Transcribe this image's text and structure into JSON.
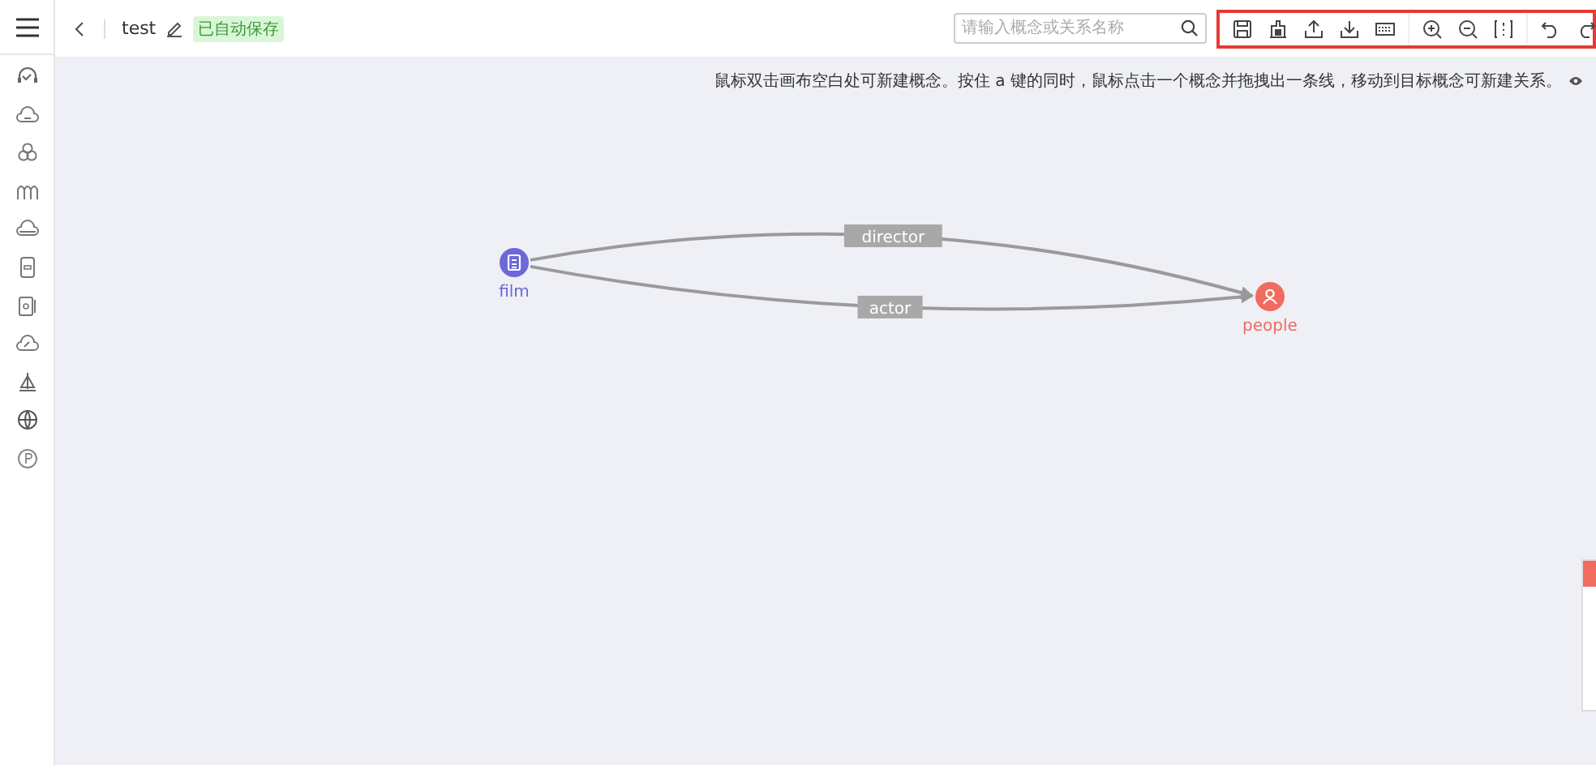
{
  "header": {
    "title": "test",
    "save_status": "已自动保存"
  },
  "search": {
    "placeholder": "请输入概念或关系名称"
  },
  "hint": "鼠标双击画布空白处可新建概念。按住 a 键的同时，鼠标点击一个概念并拖拽出一条线，移动到目标概念可新建关系。",
  "graph": {
    "nodes": [
      {
        "name": "film",
        "color": "#6c68d8"
      },
      {
        "name": "people",
        "color": "#f26b5f"
      }
    ],
    "edges": [
      {
        "label": "director"
      },
      {
        "label": "actor"
      }
    ]
  }
}
